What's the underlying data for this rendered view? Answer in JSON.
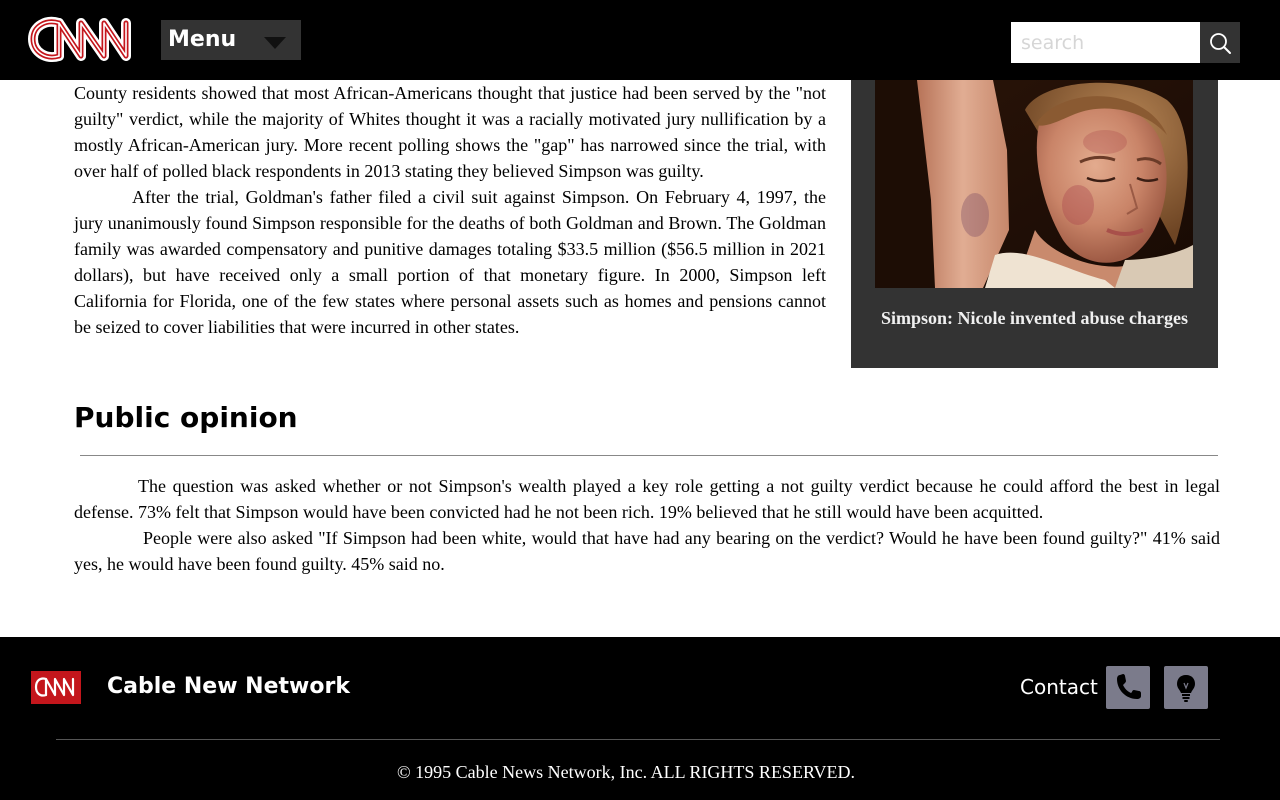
{
  "header": {
    "logo_text": "CNN",
    "menu_label": "Menu",
    "search_placeholder": "search"
  },
  "article": {
    "paragraphs": [
      "County residents showed that most African-Americans thought that justice had been served by the \"not guilty\" verdict, while the majority of Whites thought it was a racially motivated jury nullification by a mostly African-American jury. More recent polling shows the \"gap\" has narrowed since the trial, with over half of polled black respondents in 2013 stating they believed Simpson was guilty.",
      "After the trial, Goldman's father filed a civil suit against Simpson. On February 4, 1997, the jury unanimously found Simpson responsible for the deaths of both Goldman and Brown. The Goldman family was awarded compensatory and punitive damages totaling $33.5 million ($56.5 million in 2021 dollars), but have received only a small portion of that monetary figure. In 2000, Simpson left California for Florida, one of the few states where personal assets such as homes and pensions cannot be seized to cover liabilities that were incurred in other states."
    ],
    "figure_caption": "Simpson: Nicole invented abuse charges"
  },
  "section": {
    "title": "Public opinion",
    "paragraphs": [
      "The question was asked whether or not Simpson's wealth played a key role getting a not guilty verdict because he could afford the best in legal defense. 73% felt that Simpson would have been convicted had he not been rich. 19% believed that he still would have been acquitted.",
      "People were also asked \"If Simpson had been white, would that have had any bearing on the verdict? Would he have been found guilty?\" 41% said yes, he would have been found guilty. 45% said no."
    ]
  },
  "footer": {
    "logo_text": "CNN",
    "brand": "Cable New Network",
    "contact_label": "Contact",
    "copyright": "© 1995 Cable News Network, Inc. ALL RIGHTS RESERVED."
  },
  "icons": {
    "search": "search-icon",
    "phone": "phone-icon",
    "idea": "lightbulb-icon",
    "menu_caret": "chevron-down-icon"
  },
  "colors": {
    "brand_red": "#c4161c",
    "header_bg": "#000000",
    "figure_bg": "#333333",
    "footer_button": "#7b7b8b"
  }
}
